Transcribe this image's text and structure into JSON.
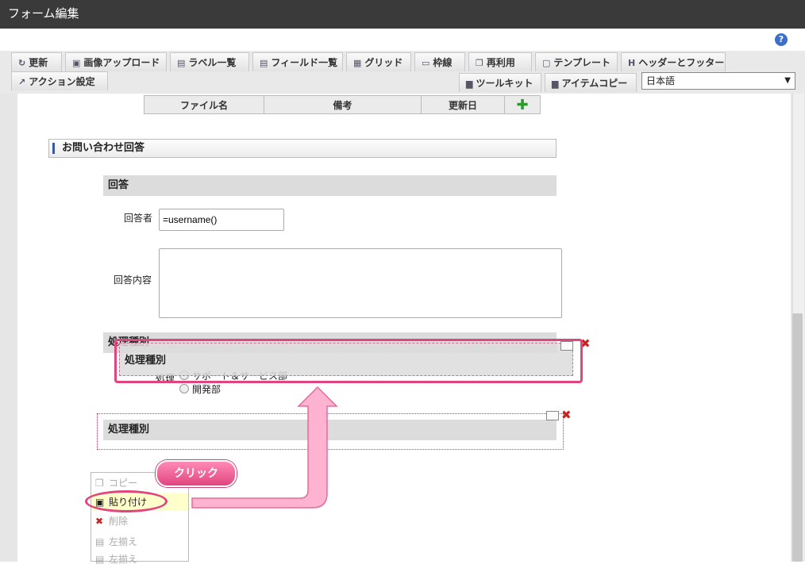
{
  "window": {
    "title": "フォーム編集"
  },
  "toolbar": {
    "row1": [
      {
        "label": "更新",
        "icon": "update-icon"
      },
      {
        "label": "画像アップロード",
        "icon": "image-upload-icon"
      },
      {
        "label": "ラベル一覧",
        "icon": "label-list-icon"
      },
      {
        "label": "フィールド一覧",
        "icon": "field-list-icon"
      },
      {
        "label": "グリッド",
        "icon": "grid-icon"
      },
      {
        "label": "枠線",
        "icon": "border-icon"
      },
      {
        "label": "再利用",
        "icon": "reuse-icon"
      },
      {
        "label": "テンプレート",
        "icon": "template-icon"
      },
      {
        "label": "ヘッダーとフッター",
        "icon": "header-footer-icon"
      }
    ],
    "row2_left": [
      {
        "label": "アクション設定",
        "icon": "action-icon"
      }
    ],
    "row2_right": [
      {
        "label": "ツールキット",
        "icon": "toolkit-icon"
      },
      {
        "label": "アイテムコピー",
        "icon": "item-copy-icon"
      }
    ],
    "language": "日本語"
  },
  "file_table": {
    "headers": [
      "ファイル名",
      "備考",
      "更新日"
    ]
  },
  "form": {
    "section_title": "お問い合わせ回答",
    "answer_header": "回答",
    "respondent_label": "回答者",
    "respondent_value": "=username()",
    "content_label": "回答内容",
    "content_value": "",
    "process_header": "処理種別",
    "dragged_header": "処理種別",
    "process_label": "処理",
    "process_options": [
      "サポート＆サービス部",
      "開発部"
    ],
    "pasted_header": "処理種別"
  },
  "context_menu": {
    "items": [
      {
        "label": "コピー",
        "icon": "copy-icon",
        "enabled": false
      },
      {
        "label": "貼り付け",
        "icon": "paste-icon",
        "enabled": true
      },
      {
        "label": "削除",
        "icon": "delete-icon",
        "enabled": false
      },
      {
        "label": "左揃え",
        "icon": "align-left-icon",
        "enabled": false
      },
      {
        "label": "左揃え",
        "icon": "align-left-icon",
        "enabled": false
      }
    ]
  },
  "annotation": {
    "callout": "クリック"
  },
  "colors": {
    "highlight": "#e0457e",
    "titlebar": "#3a3a3a"
  }
}
